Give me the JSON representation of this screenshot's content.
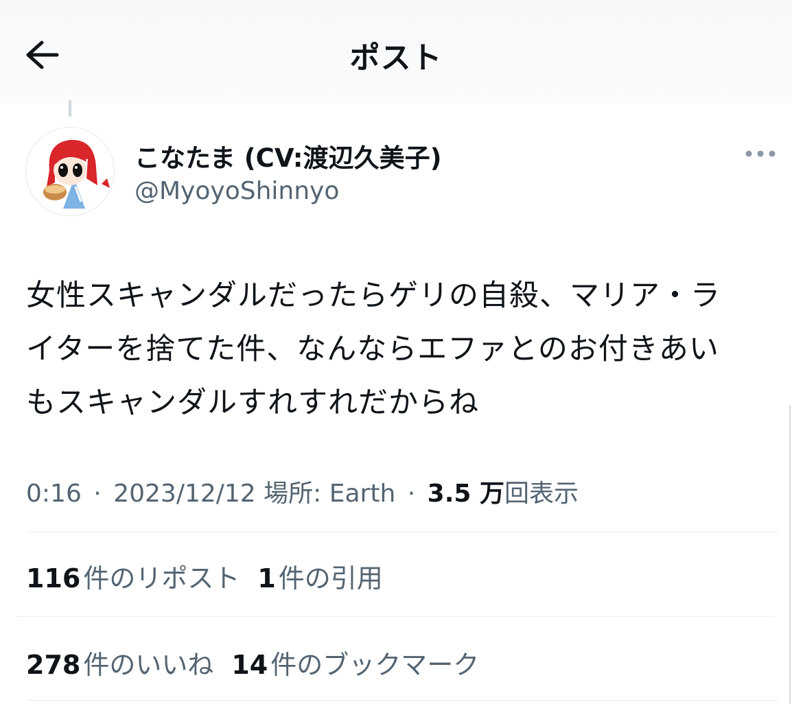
{
  "header": {
    "title": "ポスト",
    "back_icon": "arrow-left-icon"
  },
  "author": {
    "display_name": "こなたま (CV:渡辺久美子)",
    "handle": "@MyoyoShinnyo",
    "avatar_icon": "user-avatar",
    "more_icon": "more-horizontal-icon"
  },
  "tweet": {
    "lines": [
      "女性スキャンダルだったらゲリの自殺、マリア・ラ",
      "イターを捨てた件、なんならエファとのお付きあい",
      "もスキャンダルすれすれだからね"
    ]
  },
  "meta": {
    "time": "0:16",
    "separator": "·",
    "date": "2023/12/12",
    "location": "場所: Earth",
    "views_count": "3.5 万",
    "views_label": "回表示"
  },
  "stats": {
    "reposts_count": "116",
    "reposts_label": "件のリポスト",
    "quotes_count": "1",
    "quotes_label": "件の引用",
    "likes_count": "278",
    "likes_label": "件のいいね",
    "bookmarks_count": "14",
    "bookmarks_label": "件のブックマーク"
  },
  "colors": {
    "text_primary": "#0f1419",
    "text_secondary": "#536471",
    "divider": "#e6ecf0",
    "avatar_hair": "#d9262b",
    "avatar_dress": "#7fb2e5"
  }
}
